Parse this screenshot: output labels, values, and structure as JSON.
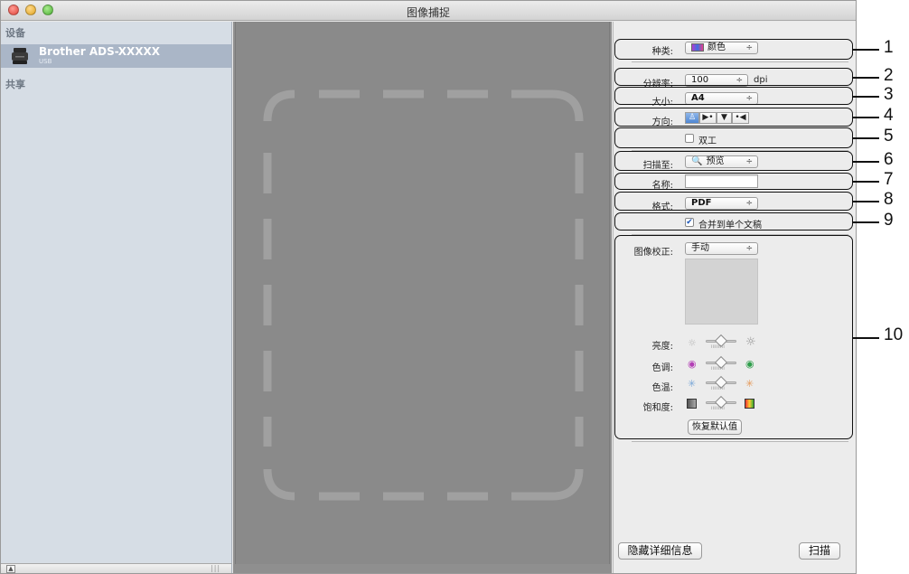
{
  "window": {
    "title": "图像捕捉"
  },
  "sidebar": {
    "devices_heading": "设备",
    "device_name": "Brother ADS-XXXXX",
    "device_connection": "USB",
    "shared_heading": "共享"
  },
  "settings": {
    "kind_label": "种类:",
    "kind_value": "颜色",
    "resolution_label": "分辨率:",
    "resolution_value": "100",
    "resolution_unit": "dpi",
    "size_label": "大小:",
    "size_value": "A4",
    "orientation_label": "方向:",
    "duplex_label": "双工",
    "duplex_checked": false,
    "scan_to_label": "扫描至:",
    "scan_to_value": "预览",
    "name_label": "名称:",
    "name_value": "",
    "format_label": "格式:",
    "format_value": "PDF",
    "combine_label": "合并到单个文稿",
    "combine_checked": true,
    "correction_label": "图像校正:",
    "correction_value": "手动",
    "brightness_label": "亮度:",
    "tint_label": "色调:",
    "temperature_label": "色温:",
    "saturation_label": "饱和度:",
    "restore_defaults": "恢复默认值",
    "hide_details": "隐藏详细信息",
    "scan_button": "扫描"
  },
  "callouts": [
    "1",
    "2",
    "3",
    "4",
    "5",
    "6",
    "7",
    "8",
    "9",
    "10"
  ]
}
